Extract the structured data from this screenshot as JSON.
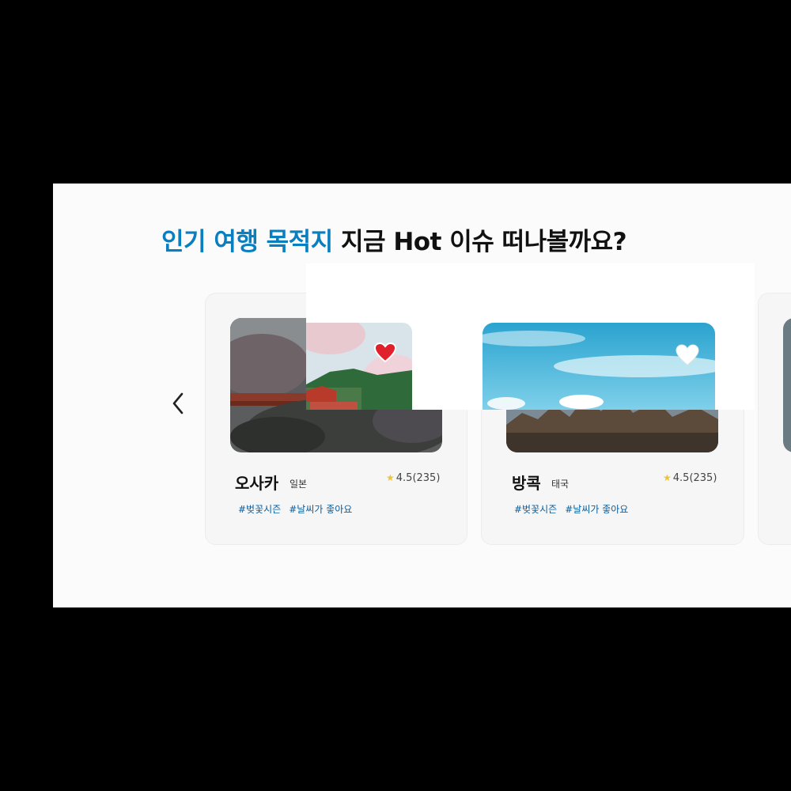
{
  "section": {
    "title_accent": "인기 여행 목적지",
    "title_rest": " 지금 Hot 이슈 떠나볼까요?"
  },
  "carousel": {
    "prev_icon": "chevron-left-icon",
    "cards": [
      {
        "city": "오사카",
        "country": "일본",
        "rating": "4.5(235)",
        "tags": [
          "#벚꽃시즌",
          "#날씨가 좋아요"
        ],
        "favorited": true
      },
      {
        "city": "방콕",
        "country": "태국",
        "rating": "4.5(235)",
        "tags": [
          "#벚꽃시즌",
          "#날씨가 좋아요"
        ],
        "favorited": false
      }
    ]
  },
  "colors": {
    "accent": "#0a7fc0",
    "heart_active": "#e0202a",
    "heart_inactive": "#ffffff",
    "rating_star": "#f1c232"
  }
}
